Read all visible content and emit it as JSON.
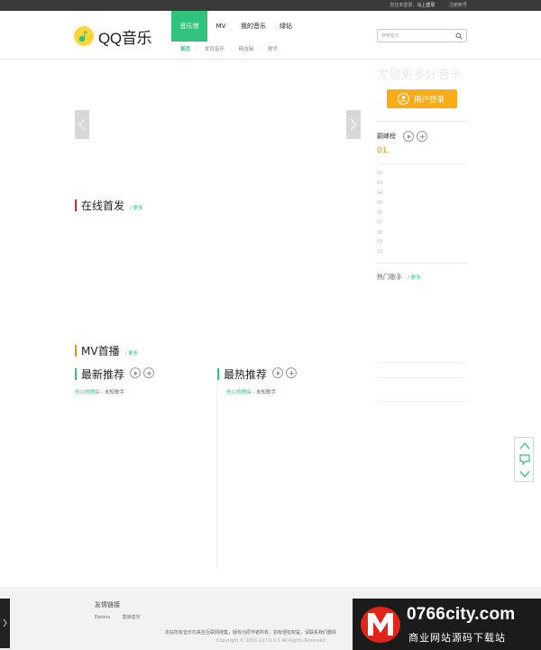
{
  "topbar": {
    "not_logged": "您还未登录，",
    "login_now": "马上登录",
    "register": "注册帐号"
  },
  "header": {
    "logo_text": "QQ音乐",
    "nav": [
      "音乐馆",
      "MV",
      "我的音乐",
      "绿钻"
    ],
    "subnav": [
      "首页",
      "发现音乐",
      "精选辑",
      "歌手"
    ],
    "search_placeholder": "搜索音乐"
  },
  "sections": {
    "online": {
      "title": "在线首发",
      "more": "/ 更多"
    },
    "mv": {
      "title": "MV首播",
      "more": "/ 更多"
    },
    "latest": {
      "title": "最新推荐",
      "song_title": "伤心的理由",
      "song_sep": " - ",
      "song_artist": "未知歌手"
    },
    "hottest": {
      "title": "最热推荐",
      "song_title": "伤心的理由",
      "song_sep": " - ",
      "song_artist": "未知歌手"
    }
  },
  "right_panel": {
    "discover": "发现更多好音乐",
    "login_button": "用户登录",
    "chart_name": "巅峰榜",
    "first_rank": "01.",
    "ranks": [
      "02",
      "03",
      "04",
      "05",
      "06",
      "07",
      "08",
      "09",
      "10"
    ],
    "hot_singers": "热门歌手",
    "more": "/ 更多"
  },
  "footer": {
    "friend_links_title": "友情链接",
    "links": [
      "Earons",
      "莫染音乐"
    ],
    "notice": "本站所有音乐均来自互联网搜集，版权为原作者所有，如有侵犯权益，请联系我们删除",
    "copyright": "Copyright © 2016 127.0.0.1 All Rights Reserved"
  },
  "watermark": {
    "site": "0766city.com",
    "tagline": "商业网站源码下载站"
  },
  "colors": {
    "brand_green": "#31c27c",
    "accent_orange": "#f8ac1a",
    "section_red": "#e0262b",
    "section_orange": "#f08a24"
  }
}
